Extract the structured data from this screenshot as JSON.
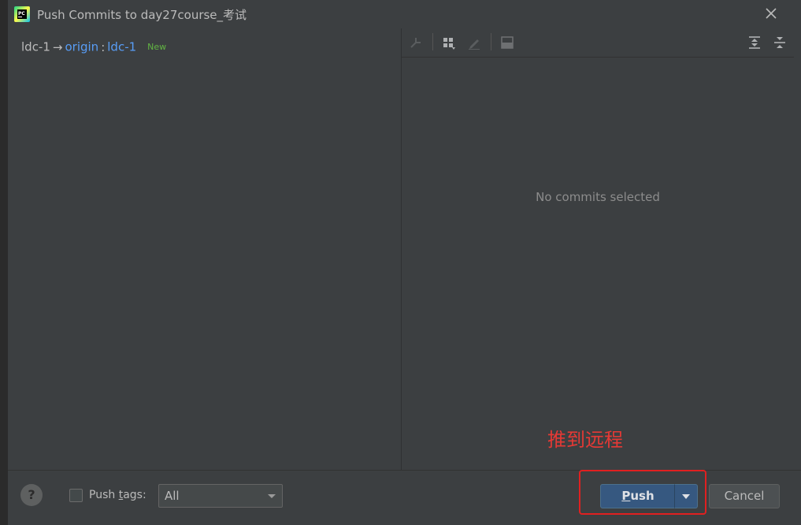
{
  "window": {
    "title": "Push Commits to day27course_考试",
    "app_icon": "pycharm-icon"
  },
  "branches": {
    "local": "ldc-1",
    "arrow": "→",
    "remote_name": "origin",
    "separator": ":",
    "remote_branch": "ldc-1",
    "badge": "New"
  },
  "details": {
    "empty_text": "No commits selected"
  },
  "toolbar": {
    "icons": [
      "cherry-pick-icon",
      "group-icon",
      "edit-icon",
      "layout-icon",
      "expand-all-icon",
      "collapse-all-icon"
    ]
  },
  "footer": {
    "help_label": "?",
    "push_tags_prefix": "Push ",
    "push_tags_mnemonic": "t",
    "push_tags_suffix": "ags:",
    "tags_select_value": "All",
    "push_mnemonic": "P",
    "push_rest": "ush",
    "cancel_label": "Cancel"
  },
  "annotation": {
    "text": "推到远程",
    "color": "#e53935"
  },
  "colors": {
    "background": "#3c3f41",
    "link": "#589df6",
    "badge": "#62b543",
    "primary_button": "#365880"
  }
}
